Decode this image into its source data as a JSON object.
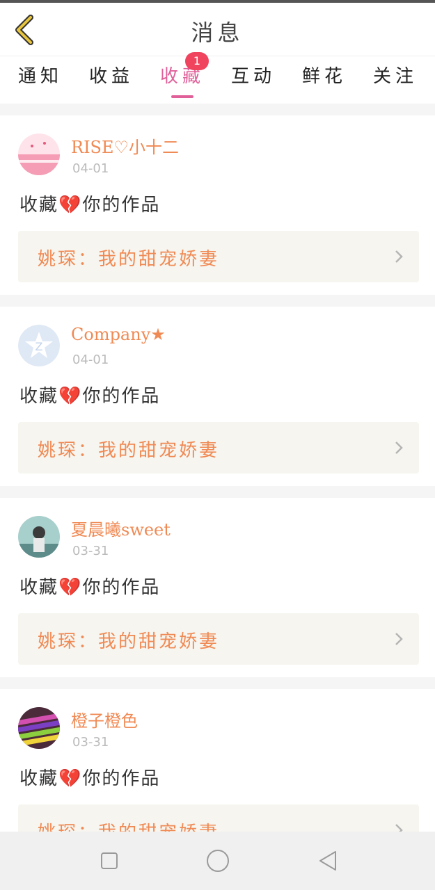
{
  "header": {
    "title": "消息"
  },
  "tabs": [
    {
      "label": "通知"
    },
    {
      "label": "收益"
    },
    {
      "label": "收藏",
      "badge": "1"
    },
    {
      "label": "互动"
    },
    {
      "label": "鲜花"
    },
    {
      "label": "关注"
    }
  ],
  "notifications": [
    {
      "username": "RISE♡小十二",
      "date": "04-01",
      "action": "收藏💔你的作品",
      "work": "姚琛：我的甜宠娇妻",
      "avatar_colors": [
        "#ffdbe3",
        "#f7a2b8"
      ]
    },
    {
      "username": "Company★",
      "date": "04-01",
      "action": "收藏💔你的作品",
      "work": "姚琛：我的甜宠娇妻",
      "avatar_colors": [
        "#dfe8f5",
        "#ffffff"
      ]
    },
    {
      "username": "夏晨曦sweet",
      "date": "03-31",
      "action": "收藏💔你的作品",
      "work": "姚琛：我的甜宠娇妻",
      "avatar_colors": [
        "#9ec9c6",
        "#4a6c6d"
      ]
    },
    {
      "username": "橙子橙色",
      "date": "03-31",
      "action": "收藏💔你的作品",
      "work": "姚琛：我的甜宠娇妻",
      "avatar_colors": [
        "#c25aa3",
        "#7fc243"
      ]
    }
  ],
  "colors": {
    "accent": "#e0609a",
    "orange": "#f08a54",
    "badge": "#f0435d",
    "back_arrow": "#d9b636"
  },
  "icons": {
    "back": "chevron-left-icon",
    "chevron": "chevron-right-icon",
    "nav_recent": "square-icon",
    "nav_home": "circle-icon",
    "nav_back": "triangle-back-icon"
  }
}
